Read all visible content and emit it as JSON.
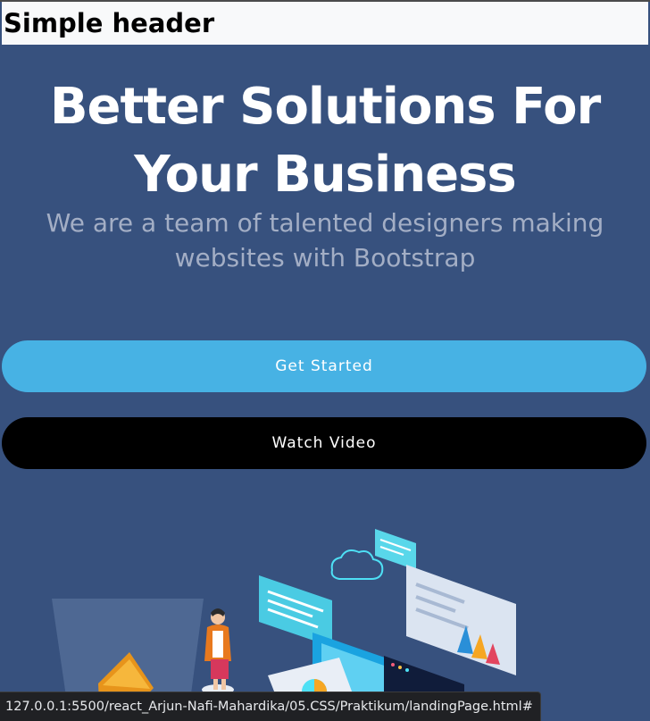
{
  "header": {
    "title": "Simple header"
  },
  "hero": {
    "title_line1": "Better Solutions For",
    "title_line2": "Your Business",
    "subtitle": "We are a team of talented designers making websites with Bootstrap"
  },
  "buttons": {
    "get_started": "Get Started",
    "watch_video": "Watch Video"
  },
  "status_bar": {
    "url": "127.0.0.1:5500/react_Arjun-Nafi-Mahardika/05.CSS/Praktikum/landingPage.html#"
  },
  "colors": {
    "hero_background": "#37517e",
    "accent": "#47b2e4",
    "subtitle": "#a3aec5",
    "header_background": "#f8f9fa"
  }
}
